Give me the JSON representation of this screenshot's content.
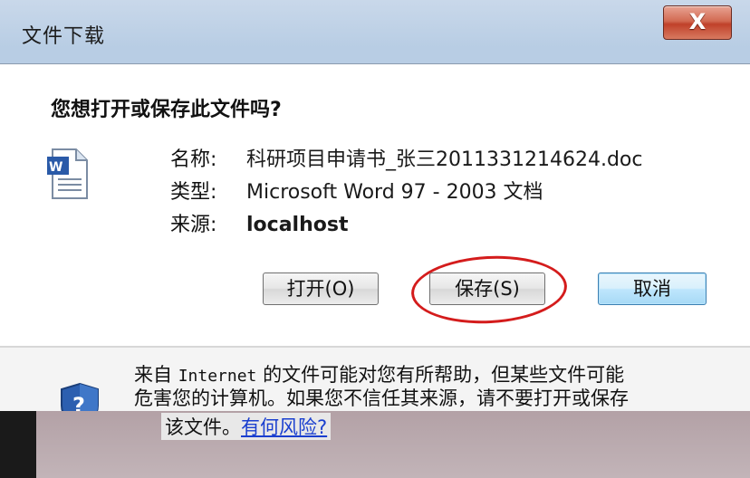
{
  "window": {
    "title": "文件下载",
    "close_label": "X"
  },
  "dialog": {
    "question": "您想打开或保存此文件吗?",
    "labels": {
      "name": "名称:",
      "type": "类型:",
      "source": "来源:"
    },
    "values": {
      "name": "科研项目申请书_张三2011331214624.doc",
      "type": "Microsoft Word 97 - 2003 文档",
      "source": "localhost"
    },
    "buttons": {
      "open": "打开(O)",
      "save": "保存(S)",
      "cancel": "取消"
    }
  },
  "warning": {
    "line1_prefix": "来自 ",
    "line1_mono": "Internet",
    "line1_suffix": " 的文件可能对您有所帮助，但某些文件可能",
    "line2": "危害您的计算机。如果您不信任其来源，请不要打开或保存",
    "line3_prefix": "该文件。",
    "risk_link": "有何风险?"
  },
  "icons": {
    "document": "word-doc-icon",
    "shield": "shield-question-icon",
    "close": "close-icon"
  },
  "colors": {
    "annotation_ring": "#d41c1c",
    "link": "#1a3fcf",
    "close_button": "#c0412a"
  }
}
